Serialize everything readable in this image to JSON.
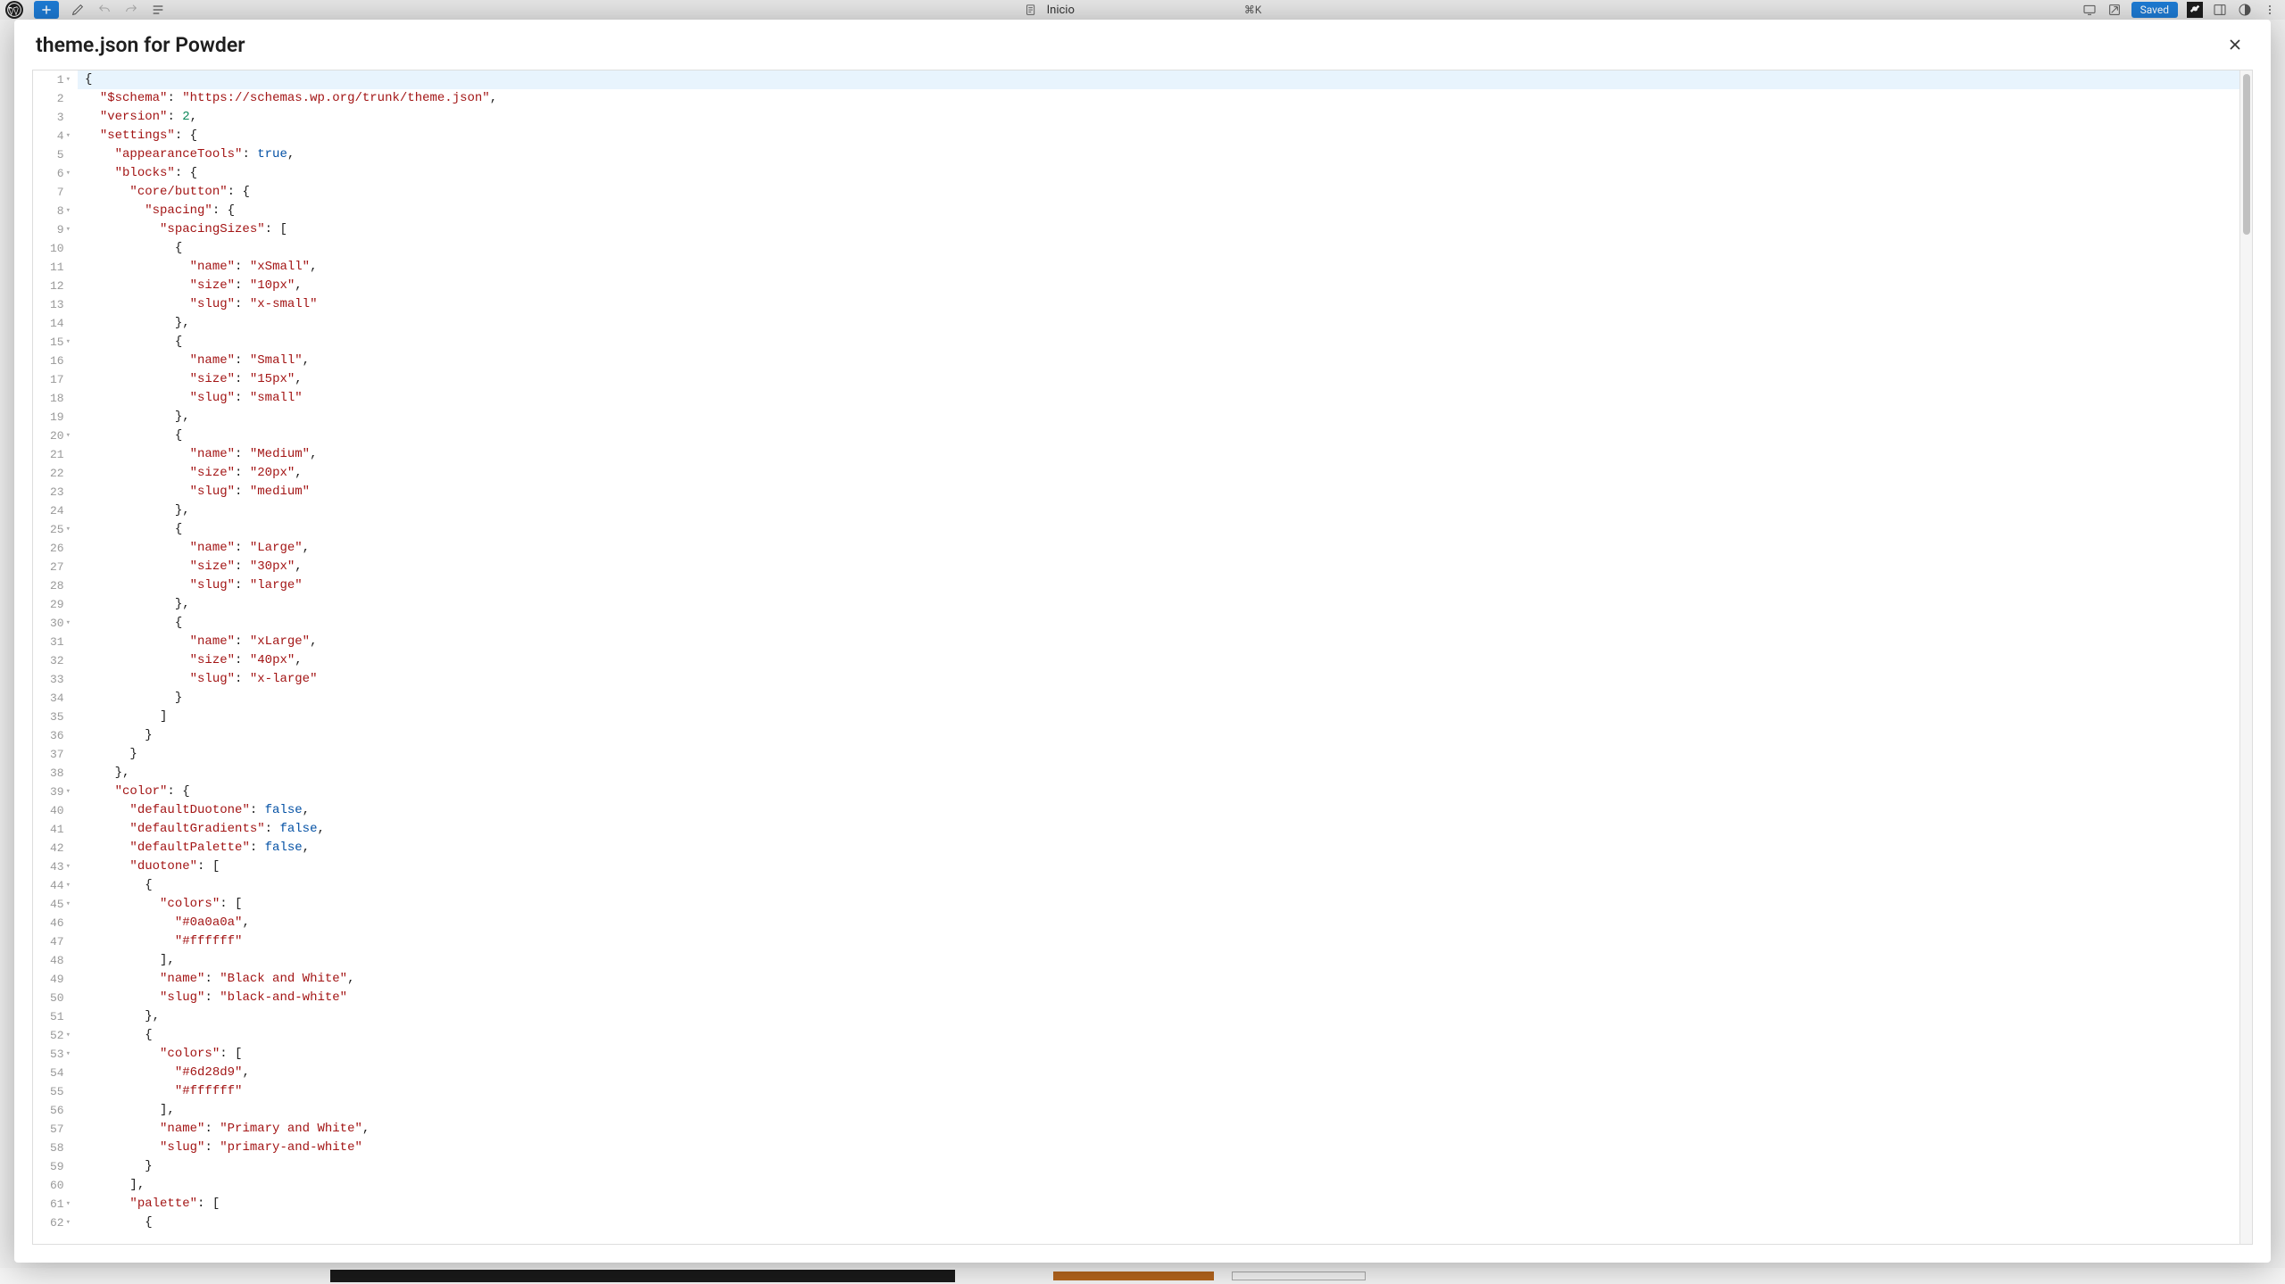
{
  "toolbar": {
    "center_label": "Inicio",
    "shortcut": "⌘K",
    "saved_label": "Saved"
  },
  "modal": {
    "title": "theme.json for Powder"
  },
  "code": {
    "lines": [
      {
        "n": 1,
        "fold": true,
        "tokens": [
          [
            "punc",
            "{"
          ]
        ]
      },
      {
        "n": 2,
        "fold": false,
        "indent": 1,
        "tokens": [
          [
            "key",
            "\"$schema\""
          ],
          [
            "punc",
            ": "
          ],
          [
            "str",
            "\"https://schemas.wp.org/trunk/theme.json\""
          ],
          [
            "punc",
            ","
          ]
        ]
      },
      {
        "n": 3,
        "fold": false,
        "indent": 1,
        "tokens": [
          [
            "key",
            "\"version\""
          ],
          [
            "punc",
            ": "
          ],
          [
            "num",
            "2"
          ],
          [
            "punc",
            ","
          ]
        ]
      },
      {
        "n": 4,
        "fold": true,
        "indent": 1,
        "tokens": [
          [
            "key",
            "\"settings\""
          ],
          [
            "punc",
            ": {"
          ]
        ]
      },
      {
        "n": 5,
        "fold": false,
        "indent": 2,
        "tokens": [
          [
            "key",
            "\"appearanceTools\""
          ],
          [
            "punc",
            ": "
          ],
          [
            "bool",
            "true"
          ],
          [
            "punc",
            ","
          ]
        ]
      },
      {
        "n": 6,
        "fold": true,
        "indent": 2,
        "tokens": [
          [
            "key",
            "\"blocks\""
          ],
          [
            "punc",
            ": {"
          ]
        ]
      },
      {
        "n": 7,
        "fold": false,
        "indent": 3,
        "tokens": [
          [
            "key",
            "\"core/button\""
          ],
          [
            "punc",
            ": {"
          ]
        ]
      },
      {
        "n": 8,
        "fold": true,
        "indent": 4,
        "tokens": [
          [
            "key",
            "\"spacing\""
          ],
          [
            "punc",
            ": {"
          ]
        ]
      },
      {
        "n": 9,
        "fold": true,
        "indent": 5,
        "tokens": [
          [
            "key",
            "\"spacingSizes\""
          ],
          [
            "punc",
            ": ["
          ]
        ]
      },
      {
        "n": 10,
        "fold": false,
        "indent": 6,
        "tokens": [
          [
            "punc",
            "{"
          ]
        ]
      },
      {
        "n": 11,
        "fold": false,
        "indent": 7,
        "tokens": [
          [
            "key",
            "\"name\""
          ],
          [
            "punc",
            ": "
          ],
          [
            "str",
            "\"xSmall\""
          ],
          [
            "punc",
            ","
          ]
        ]
      },
      {
        "n": 12,
        "fold": false,
        "indent": 7,
        "tokens": [
          [
            "key",
            "\"size\""
          ],
          [
            "punc",
            ": "
          ],
          [
            "str",
            "\"10px\""
          ],
          [
            "punc",
            ","
          ]
        ]
      },
      {
        "n": 13,
        "fold": false,
        "indent": 7,
        "tokens": [
          [
            "key",
            "\"slug\""
          ],
          [
            "punc",
            ": "
          ],
          [
            "str",
            "\"x-small\""
          ]
        ]
      },
      {
        "n": 14,
        "fold": false,
        "indent": 6,
        "tokens": [
          [
            "punc",
            "},"
          ]
        ]
      },
      {
        "n": 15,
        "fold": true,
        "indent": 6,
        "tokens": [
          [
            "punc",
            "{"
          ]
        ]
      },
      {
        "n": 16,
        "fold": false,
        "indent": 7,
        "tokens": [
          [
            "key",
            "\"name\""
          ],
          [
            "punc",
            ": "
          ],
          [
            "str",
            "\"Small\""
          ],
          [
            "punc",
            ","
          ]
        ]
      },
      {
        "n": 17,
        "fold": false,
        "indent": 7,
        "tokens": [
          [
            "key",
            "\"size\""
          ],
          [
            "punc",
            ": "
          ],
          [
            "str",
            "\"15px\""
          ],
          [
            "punc",
            ","
          ]
        ]
      },
      {
        "n": 18,
        "fold": false,
        "indent": 7,
        "tokens": [
          [
            "key",
            "\"slug\""
          ],
          [
            "punc",
            ": "
          ],
          [
            "str",
            "\"small\""
          ]
        ]
      },
      {
        "n": 19,
        "fold": false,
        "indent": 6,
        "tokens": [
          [
            "punc",
            "},"
          ]
        ]
      },
      {
        "n": 20,
        "fold": true,
        "indent": 6,
        "tokens": [
          [
            "punc",
            "{"
          ]
        ]
      },
      {
        "n": 21,
        "fold": false,
        "indent": 7,
        "tokens": [
          [
            "key",
            "\"name\""
          ],
          [
            "punc",
            ": "
          ],
          [
            "str",
            "\"Medium\""
          ],
          [
            "punc",
            ","
          ]
        ]
      },
      {
        "n": 22,
        "fold": false,
        "indent": 7,
        "tokens": [
          [
            "key",
            "\"size\""
          ],
          [
            "punc",
            ": "
          ],
          [
            "str",
            "\"20px\""
          ],
          [
            "punc",
            ","
          ]
        ]
      },
      {
        "n": 23,
        "fold": false,
        "indent": 7,
        "tokens": [
          [
            "key",
            "\"slug\""
          ],
          [
            "punc",
            ": "
          ],
          [
            "str",
            "\"medium\""
          ]
        ]
      },
      {
        "n": 24,
        "fold": false,
        "indent": 6,
        "tokens": [
          [
            "punc",
            "},"
          ]
        ]
      },
      {
        "n": 25,
        "fold": true,
        "indent": 6,
        "tokens": [
          [
            "punc",
            "{"
          ]
        ]
      },
      {
        "n": 26,
        "fold": false,
        "indent": 7,
        "tokens": [
          [
            "key",
            "\"name\""
          ],
          [
            "punc",
            ": "
          ],
          [
            "str",
            "\"Large\""
          ],
          [
            "punc",
            ","
          ]
        ]
      },
      {
        "n": 27,
        "fold": false,
        "indent": 7,
        "tokens": [
          [
            "key",
            "\"size\""
          ],
          [
            "punc",
            ": "
          ],
          [
            "str",
            "\"30px\""
          ],
          [
            "punc",
            ","
          ]
        ]
      },
      {
        "n": 28,
        "fold": false,
        "indent": 7,
        "tokens": [
          [
            "key",
            "\"slug\""
          ],
          [
            "punc",
            ": "
          ],
          [
            "str",
            "\"large\""
          ]
        ]
      },
      {
        "n": 29,
        "fold": false,
        "indent": 6,
        "tokens": [
          [
            "punc",
            "},"
          ]
        ]
      },
      {
        "n": 30,
        "fold": true,
        "indent": 6,
        "tokens": [
          [
            "punc",
            "{"
          ]
        ]
      },
      {
        "n": 31,
        "fold": false,
        "indent": 7,
        "tokens": [
          [
            "key",
            "\"name\""
          ],
          [
            "punc",
            ": "
          ],
          [
            "str",
            "\"xLarge\""
          ],
          [
            "punc",
            ","
          ]
        ]
      },
      {
        "n": 32,
        "fold": false,
        "indent": 7,
        "tokens": [
          [
            "key",
            "\"size\""
          ],
          [
            "punc",
            ": "
          ],
          [
            "str",
            "\"40px\""
          ],
          [
            "punc",
            ","
          ]
        ]
      },
      {
        "n": 33,
        "fold": false,
        "indent": 7,
        "tokens": [
          [
            "key",
            "\"slug\""
          ],
          [
            "punc",
            ": "
          ],
          [
            "str",
            "\"x-large\""
          ]
        ]
      },
      {
        "n": 34,
        "fold": false,
        "indent": 6,
        "tokens": [
          [
            "punc",
            "}"
          ]
        ]
      },
      {
        "n": 35,
        "fold": false,
        "indent": 5,
        "tokens": [
          [
            "punc",
            "]"
          ]
        ]
      },
      {
        "n": 36,
        "fold": false,
        "indent": 4,
        "tokens": [
          [
            "punc",
            "}"
          ]
        ]
      },
      {
        "n": 37,
        "fold": false,
        "indent": 3,
        "tokens": [
          [
            "punc",
            "}"
          ]
        ]
      },
      {
        "n": 38,
        "fold": false,
        "indent": 2,
        "tokens": [
          [
            "punc",
            "},"
          ]
        ]
      },
      {
        "n": 39,
        "fold": true,
        "indent": 2,
        "tokens": [
          [
            "key",
            "\"color\""
          ],
          [
            "punc",
            ": {"
          ]
        ]
      },
      {
        "n": 40,
        "fold": false,
        "indent": 3,
        "tokens": [
          [
            "key",
            "\"defaultDuotone\""
          ],
          [
            "punc",
            ": "
          ],
          [
            "bool",
            "false"
          ],
          [
            "punc",
            ","
          ]
        ]
      },
      {
        "n": 41,
        "fold": false,
        "indent": 3,
        "tokens": [
          [
            "key",
            "\"defaultGradients\""
          ],
          [
            "punc",
            ": "
          ],
          [
            "bool",
            "false"
          ],
          [
            "punc",
            ","
          ]
        ]
      },
      {
        "n": 42,
        "fold": false,
        "indent": 3,
        "tokens": [
          [
            "key",
            "\"defaultPalette\""
          ],
          [
            "punc",
            ": "
          ],
          [
            "bool",
            "false"
          ],
          [
            "punc",
            ","
          ]
        ]
      },
      {
        "n": 43,
        "fold": true,
        "indent": 3,
        "tokens": [
          [
            "key",
            "\"duotone\""
          ],
          [
            "punc",
            ": ["
          ]
        ]
      },
      {
        "n": 44,
        "fold": true,
        "indent": 4,
        "tokens": [
          [
            "punc",
            "{"
          ]
        ]
      },
      {
        "n": 45,
        "fold": true,
        "indent": 5,
        "tokens": [
          [
            "key",
            "\"colors\""
          ],
          [
            "punc",
            ": ["
          ]
        ]
      },
      {
        "n": 46,
        "fold": false,
        "indent": 6,
        "tokens": [
          [
            "str",
            "\"#0a0a0a\""
          ],
          [
            "punc",
            ","
          ]
        ]
      },
      {
        "n": 47,
        "fold": false,
        "indent": 6,
        "tokens": [
          [
            "str",
            "\"#ffffff\""
          ]
        ]
      },
      {
        "n": 48,
        "fold": false,
        "indent": 5,
        "tokens": [
          [
            "punc",
            "],"
          ]
        ]
      },
      {
        "n": 49,
        "fold": false,
        "indent": 5,
        "tokens": [
          [
            "key",
            "\"name\""
          ],
          [
            "punc",
            ": "
          ],
          [
            "str",
            "\"Black and White\""
          ],
          [
            "punc",
            ","
          ]
        ]
      },
      {
        "n": 50,
        "fold": false,
        "indent": 5,
        "tokens": [
          [
            "key",
            "\"slug\""
          ],
          [
            "punc",
            ": "
          ],
          [
            "str",
            "\"black-and-white\""
          ]
        ]
      },
      {
        "n": 51,
        "fold": false,
        "indent": 4,
        "tokens": [
          [
            "punc",
            "},"
          ]
        ]
      },
      {
        "n": 52,
        "fold": true,
        "indent": 4,
        "tokens": [
          [
            "punc",
            "{"
          ]
        ]
      },
      {
        "n": 53,
        "fold": true,
        "indent": 5,
        "tokens": [
          [
            "key",
            "\"colors\""
          ],
          [
            "punc",
            ": ["
          ]
        ]
      },
      {
        "n": 54,
        "fold": false,
        "indent": 6,
        "tokens": [
          [
            "str",
            "\"#6d28d9\""
          ],
          [
            "punc",
            ","
          ]
        ]
      },
      {
        "n": 55,
        "fold": false,
        "indent": 6,
        "tokens": [
          [
            "str",
            "\"#ffffff\""
          ]
        ]
      },
      {
        "n": 56,
        "fold": false,
        "indent": 5,
        "tokens": [
          [
            "punc",
            "],"
          ]
        ]
      },
      {
        "n": 57,
        "fold": false,
        "indent": 5,
        "tokens": [
          [
            "key",
            "\"name\""
          ],
          [
            "punc",
            ": "
          ],
          [
            "str",
            "\"Primary and White\""
          ],
          [
            "punc",
            ","
          ]
        ]
      },
      {
        "n": 58,
        "fold": false,
        "indent": 5,
        "tokens": [
          [
            "key",
            "\"slug\""
          ],
          [
            "punc",
            ": "
          ],
          [
            "str",
            "\"primary-and-white\""
          ]
        ]
      },
      {
        "n": 59,
        "fold": false,
        "indent": 4,
        "tokens": [
          [
            "punc",
            "}"
          ]
        ]
      },
      {
        "n": 60,
        "fold": false,
        "indent": 3,
        "tokens": [
          [
            "punc",
            "],"
          ]
        ]
      },
      {
        "n": 61,
        "fold": true,
        "indent": 3,
        "tokens": [
          [
            "key",
            "\"palette\""
          ],
          [
            "punc",
            ": ["
          ]
        ]
      },
      {
        "n": 62,
        "fold": true,
        "indent": 4,
        "tokens": [
          [
            "punc",
            "{"
          ]
        ]
      }
    ]
  }
}
